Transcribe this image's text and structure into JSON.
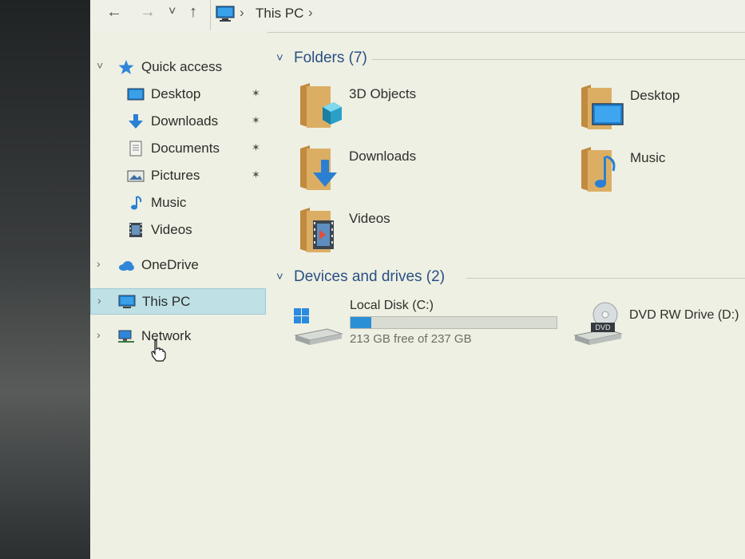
{
  "addressbar": {
    "back_glyph": "←",
    "forward_glyph": "→",
    "recent_glyph": "˅",
    "up_glyph": "↑",
    "separator": "›",
    "crumb": "This PC"
  },
  "nav": {
    "items": [
      {
        "label": "Quick access",
        "icon": "star-icon"
      },
      {
        "label": "Desktop",
        "icon": "desktop-icon",
        "pinned": true
      },
      {
        "label": "Downloads",
        "icon": "download-arrow-icon",
        "pinned": true
      },
      {
        "label": "Documents",
        "icon": "document-icon",
        "pinned": true
      },
      {
        "label": "Pictures",
        "icon": "pictures-icon",
        "pinned": true
      },
      {
        "label": "Music",
        "icon": "music-note-icon"
      },
      {
        "label": "Videos",
        "icon": "film-icon"
      },
      {
        "label": "OneDrive",
        "icon": "cloud-icon"
      },
      {
        "label": "This PC",
        "icon": "computer-icon",
        "selected": true
      },
      {
        "label": "Network",
        "icon": "network-icon"
      }
    ],
    "chevron_expanded": "˅",
    "chevron_collapsed": "›",
    "pin_glyph": "📌"
  },
  "content": {
    "folders_group": {
      "title": "Folders (7)",
      "chevron": "˅"
    },
    "folders": [
      {
        "label": "3D Objects",
        "icon": "3d-objects-folder-icon"
      },
      {
        "label": "Desktop",
        "icon": "desktop-folder-icon"
      },
      {
        "label": "Downloads",
        "icon": "downloads-folder-icon"
      },
      {
        "label": "Music",
        "icon": "music-folder-icon"
      },
      {
        "label": "Videos",
        "icon": "videos-folder-icon"
      }
    ],
    "drives_group": {
      "title": "Devices and drives (2)",
      "chevron": "˅"
    },
    "drives": [
      {
        "name": "Local Disk (C:)",
        "free_text": "213 GB free of 237 GB",
        "used_fraction": 0.101,
        "icon": "windows-drive-icon"
      },
      {
        "name": "DVD RW Drive (D:)",
        "icon": "dvd-drive-icon",
        "badge": "DVD"
      }
    ]
  },
  "colors": {
    "accent": "#2b8fd6",
    "selection": "#bfe0e5",
    "group_title": "#2a4f84",
    "folder": "#d9a75c"
  }
}
